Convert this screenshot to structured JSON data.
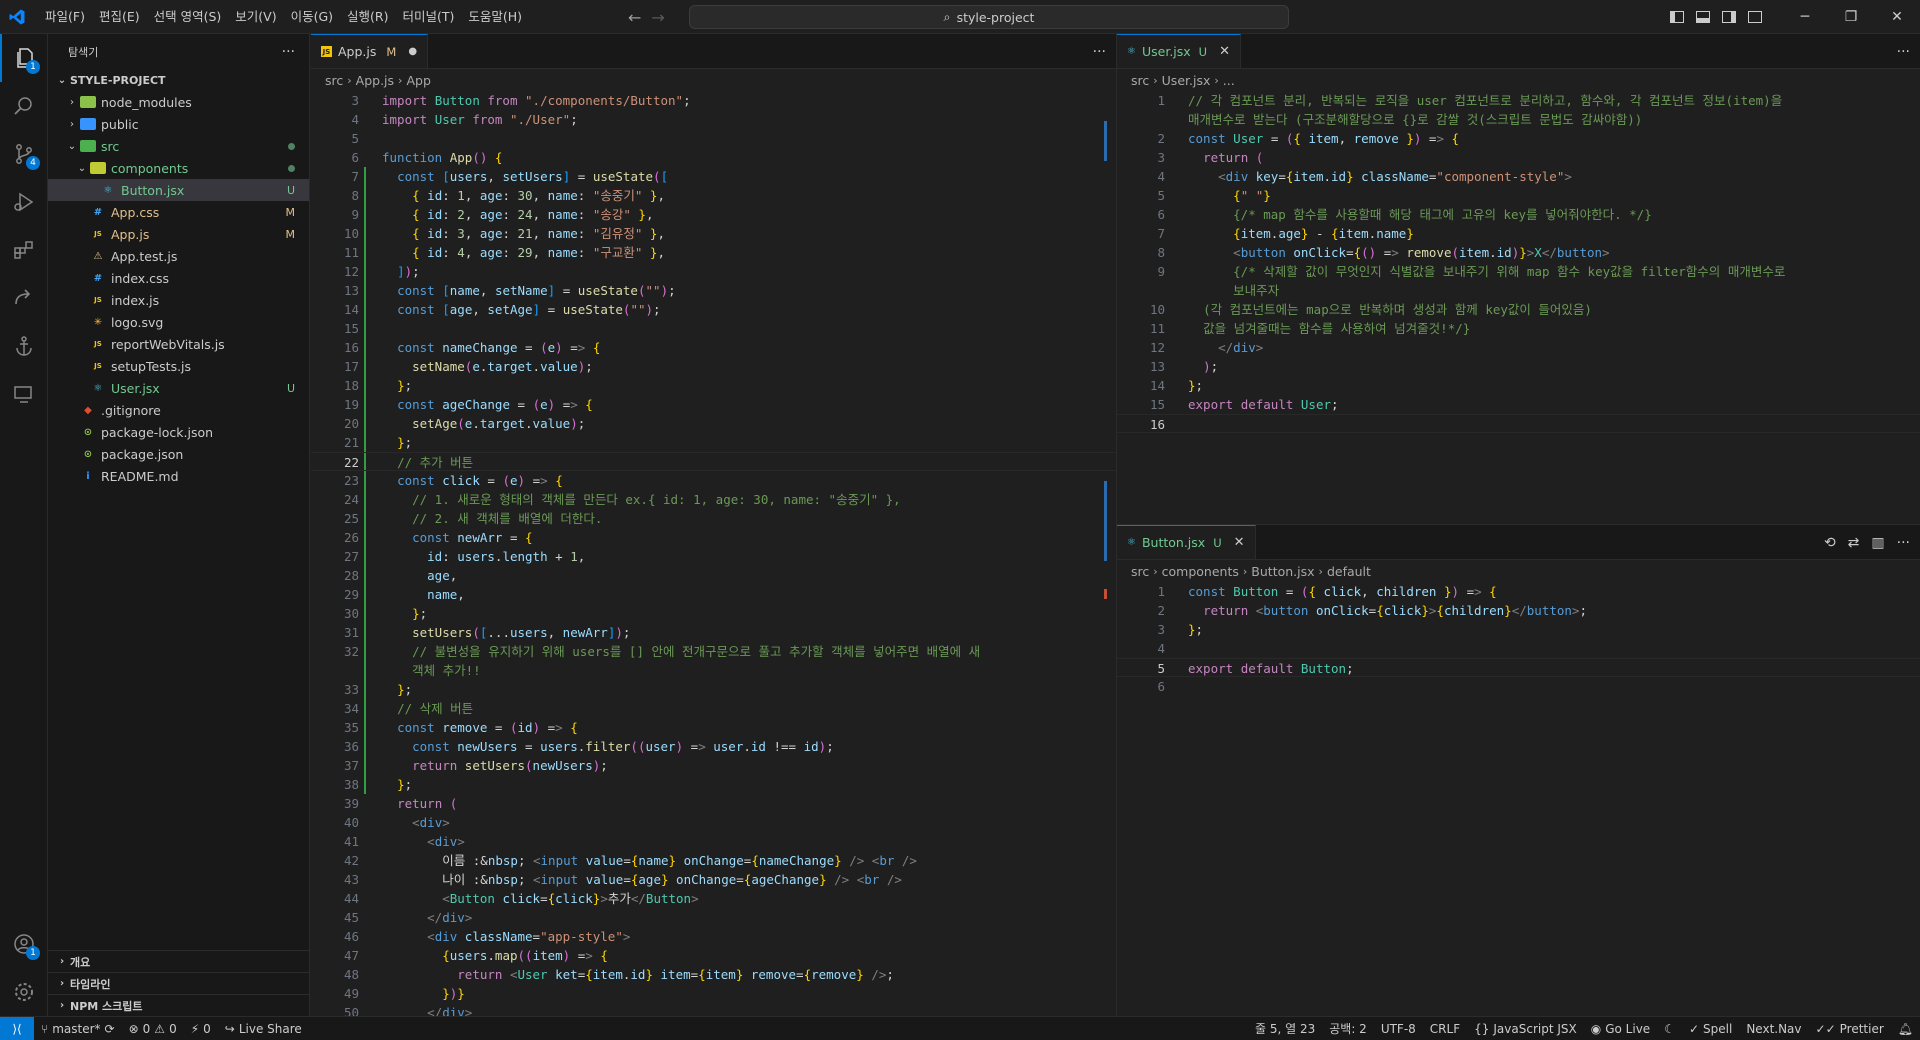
{
  "menu": [
    "파일(F)",
    "편집(E)",
    "선택 영역(S)",
    "보기(V)",
    "이동(G)",
    "실행(R)",
    "터미널(T)",
    "도움말(H)"
  ],
  "search": "style-project",
  "activity_badges": {
    "explorer": "1",
    "scm": "4",
    "accounts": "1"
  },
  "sidebar": {
    "title": "탐색기",
    "root": "STYLE-PROJECT",
    "items": [
      {
        "name": "node_modules",
        "kind": "folder",
        "depth": 1,
        "open": false,
        "status": "",
        "color": "#cccccc"
      },
      {
        "name": "public",
        "kind": "folder",
        "depth": 1,
        "open": false,
        "status": "",
        "color": "#cccccc"
      },
      {
        "name": "src",
        "kind": "folder",
        "depth": 1,
        "open": true,
        "status": "dot",
        "color": "#73c991"
      },
      {
        "name": "components",
        "kind": "folder",
        "depth": 2,
        "open": true,
        "status": "dot",
        "color": "#73c991"
      },
      {
        "name": "Button.jsx",
        "kind": "react",
        "depth": 3,
        "status": "U",
        "color": "#73c991",
        "selected": true
      },
      {
        "name": "App.css",
        "kind": "css",
        "depth": 2,
        "status": "M",
        "color": "#e2c08d"
      },
      {
        "name": "App.js",
        "kind": "js",
        "depth": 2,
        "status": "M",
        "color": "#e2c08d"
      },
      {
        "name": "App.test.js",
        "kind": "test",
        "depth": 2,
        "status": "",
        "color": "#cccccc"
      },
      {
        "name": "index.css",
        "kind": "css",
        "depth": 2,
        "status": "",
        "color": "#cccccc"
      },
      {
        "name": "index.js",
        "kind": "js",
        "depth": 2,
        "status": "",
        "color": "#cccccc"
      },
      {
        "name": "logo.svg",
        "kind": "svg",
        "depth": 2,
        "status": "",
        "color": "#cccccc"
      },
      {
        "name": "reportWebVitals.js",
        "kind": "js",
        "depth": 2,
        "status": "",
        "color": "#cccccc"
      },
      {
        "name": "setupTests.js",
        "kind": "js",
        "depth": 2,
        "status": "",
        "color": "#cccccc"
      },
      {
        "name": "User.jsx",
        "kind": "react",
        "depth": 2,
        "status": "U",
        "color": "#73c991"
      },
      {
        "name": ".gitignore",
        "kind": "git",
        "depth": 1,
        "status": "",
        "color": "#cccccc"
      },
      {
        "name": "package-lock.json",
        "kind": "json",
        "depth": 1,
        "status": "",
        "color": "#cccccc"
      },
      {
        "name": "package.json",
        "kind": "json",
        "depth": 1,
        "status": "",
        "color": "#cccccc"
      },
      {
        "name": "README.md",
        "kind": "info",
        "depth": 1,
        "status": "",
        "color": "#cccccc"
      }
    ],
    "sections": [
      "개요",
      "타임라인",
      "NPM 스크립트"
    ]
  },
  "left_editor": {
    "tab": {
      "name": "App.js",
      "status": "M"
    },
    "breadcrumb": [
      "src",
      "App.js",
      "App"
    ],
    "lines": [
      {
        "n": "3",
        "c": "import Button from \"./components/Button\";"
      },
      {
        "n": "4",
        "c": "import User from \"./User\";"
      },
      {
        "n": "5",
        "c": ""
      },
      {
        "n": "6",
        "c": "function App() {"
      },
      {
        "n": "7",
        "c": "  const [users, setUsers] = useState(["
      },
      {
        "n": "8",
        "c": "    { id: 1, age: 30, name: \"송중기\" },"
      },
      {
        "n": "9",
        "c": "    { id: 2, age: 24, name: \"송강\" },"
      },
      {
        "n": "10",
        "c": "    { id: 3, age: 21, name: \"김유정\" },"
      },
      {
        "n": "11",
        "c": "    { id: 4, age: 29, name: \"구교환\" },"
      },
      {
        "n": "12",
        "c": "  ]);"
      },
      {
        "n": "13",
        "c": "  const [name, setName] = useState(\"\");"
      },
      {
        "n": "14",
        "c": "  const [age, setAge] = useState(\"\");"
      },
      {
        "n": "15",
        "c": ""
      },
      {
        "n": "16",
        "c": "  const nameChange = (e) => {"
      },
      {
        "n": "17",
        "c": "    setName(e.target.value);"
      },
      {
        "n": "18",
        "c": "  };"
      },
      {
        "n": "19",
        "c": "  const ageChange = (e) => {"
      },
      {
        "n": "20",
        "c": "    setAge(e.target.value);"
      },
      {
        "n": "21",
        "c": "  };"
      },
      {
        "n": "22",
        "c": "  // 추가 버튼"
      },
      {
        "n": "23",
        "c": "  const click = (e) => {"
      },
      {
        "n": "24",
        "c": "    // 1. 새로운 형태의 객체를 만든다 ex.{ id: 1, age: 30, name: \"송중기\" },"
      },
      {
        "n": "25",
        "c": "    // 2. 새 객체를 배열에 더한다."
      },
      {
        "n": "26",
        "c": "    const newArr = {"
      },
      {
        "n": "27",
        "c": "      id: users.length + 1,"
      },
      {
        "n": "28",
        "c": "      age,"
      },
      {
        "n": "29",
        "c": "      name,"
      },
      {
        "n": "30",
        "c": "    };"
      },
      {
        "n": "31",
        "c": "    setUsers([...users, newArr]);"
      },
      {
        "n": "32",
        "c": "    // 불변성을 유지하기 위해 users를 [] 안에 전개구문으로 풀고 추가할 객체를 넣어주면 배열에 새"
      },
      {
        "n": "",
        "c": "    객체 추가!!"
      },
      {
        "n": "33",
        "c": "  };"
      },
      {
        "n": "34",
        "c": "  // 삭제 버튼"
      },
      {
        "n": "35",
        "c": "  const remove = (id) => {"
      },
      {
        "n": "36",
        "c": "    const newUsers = users.filter((user) => user.id !== id);"
      },
      {
        "n": "37",
        "c": "    return setUsers(newUsers);"
      },
      {
        "n": "38",
        "c": "  };"
      },
      {
        "n": "39",
        "c": "  return ("
      },
      {
        "n": "40",
        "c": "    <div>"
      },
      {
        "n": "41",
        "c": "      <div>"
      },
      {
        "n": "42",
        "c": "        이름 :&nbsp; <input value={name} onChange={nameChange} /> <br />"
      },
      {
        "n": "43",
        "c": "        나이 :&nbsp; <input value={age} onChange={ageChange} /> <br />"
      },
      {
        "n": "44",
        "c": "        <Button click={click}>추가</Button>"
      },
      {
        "n": "45",
        "c": "      </div>"
      },
      {
        "n": "46",
        "c": "      <div className=\"app-style\">"
      },
      {
        "n": "47",
        "c": "        {users.map((item) => {"
      },
      {
        "n": "48",
        "c": "          return <User ket={item.id} item={item} remove={remove} />;"
      },
      {
        "n": "49",
        "c": "        })}"
      },
      {
        "n": "50",
        "c": "      </div>"
      }
    ]
  },
  "right_top_editor": {
    "tab": {
      "name": "User.jsx",
      "status": "U"
    },
    "breadcrumb": [
      "src",
      "User.jsx",
      "..."
    ],
    "lines": [
      {
        "n": "1",
        "c": "// 각 컴포넌트 분리, 반복되는 로직을 user 컴포넌트로 분리하고, 함수와, 각 컴포넌트 정보(item)을"
      },
      {
        "n": "",
        "c": "매개변수로 받는다 (구조분해할당으로 {}로 감쌀 것(스크립트 문법도 감싸야함))"
      },
      {
        "n": "2",
        "c": "const User = ({ item, remove }) => {"
      },
      {
        "n": "3",
        "c": "  return ("
      },
      {
        "n": "4",
        "c": "    <div key={item.id} className=\"component-style\">"
      },
      {
        "n": "5",
        "c": "      {\" \"}"
      },
      {
        "n": "6",
        "c": "      {/* map 함수를 사용할때 해당 태그에 고유의 key를 넣어줘야한다. */}"
      },
      {
        "n": "7",
        "c": "      {item.age} - {item.name}"
      },
      {
        "n": "8",
        "c": "      <button onClick={() => remove(item.id)}>X</button>"
      },
      {
        "n": "9",
        "c": "      {/* 삭제할 값이 무엇인지 식별값을 보내주기 위해 map 함수 key값을 filter함수의 매개변수로"
      },
      {
        "n": "",
        "c": "      보내주자"
      },
      {
        "n": "10",
        "c": "  (각 컴포넌트에는 map으로 반복하며 생성과 함께 key값이 들어있음)"
      },
      {
        "n": "11",
        "c": "  값을 넘겨줄때는 함수를 사용하여 넘겨줄것!*/}"
      },
      {
        "n": "12",
        "c": "    </div>"
      },
      {
        "n": "13",
        "c": "  );"
      },
      {
        "n": "14",
        "c": "};"
      },
      {
        "n": "15",
        "c": "export default User;"
      },
      {
        "n": "16",
        "c": ""
      }
    ]
  },
  "right_bottom_editor": {
    "tab": {
      "name": "Button.jsx",
      "status": "U"
    },
    "breadcrumb": [
      "src",
      "components",
      "Button.jsx",
      "default"
    ],
    "lines": [
      {
        "n": "1",
        "c": "const Button = ({ click, children }) => {"
      },
      {
        "n": "2",
        "c": "  return <button onClick={click}>{children}</button>;"
      },
      {
        "n": "3",
        "c": "};"
      },
      {
        "n": "4",
        "c": ""
      },
      {
        "n": "5",
        "c": "export default Button;"
      },
      {
        "n": "6",
        "c": ""
      }
    ]
  },
  "statusbar": {
    "branch": "master*",
    "errors": "0",
    "warnings": "0",
    "ports": "0",
    "liveshare": "Live Share",
    "position": "줄 5, 열 23",
    "spaces": "공백: 2",
    "encoding": "UTF-8",
    "eol": "CRLF",
    "language": "JavaScript JSX",
    "golive": "Go Live",
    "spell": "Spell",
    "nextnav": "Next.Nav",
    "prettier": "Prettier"
  },
  "colors": {
    "accent": "#0078d4",
    "untracked": "#73c991",
    "modified": "#e2c08d"
  }
}
